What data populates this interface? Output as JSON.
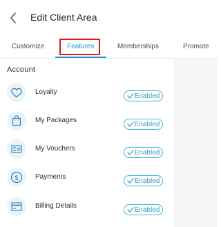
{
  "header": {
    "title": "Edit Client Area",
    "back_icon": "chevron-left-icon"
  },
  "tabs": [
    {
      "label": "Customize"
    },
    {
      "label": "Features",
      "active": true
    },
    {
      "label": "Memberships"
    },
    {
      "label": "Promote"
    }
  ],
  "section": {
    "title": "Account"
  },
  "items": [
    {
      "label": "Loyalty",
      "icon": "heart-icon",
      "status": "Enabled"
    },
    {
      "label": "My Packages",
      "icon": "shopping-bag-icon",
      "status": "Enabled"
    },
    {
      "label": "My Vouchers",
      "icon": "voucher-icon",
      "status": "Enabled"
    },
    {
      "label": "Payments",
      "icon": "dollar-circle-icon",
      "status": "Enabled"
    },
    {
      "label": "Billing Details",
      "icon": "credit-card-icon",
      "status": "Enabled"
    }
  ],
  "colors": {
    "accent": "#1b95c9",
    "highlight": "#e0141a",
    "badge": "#3bb3d6"
  }
}
